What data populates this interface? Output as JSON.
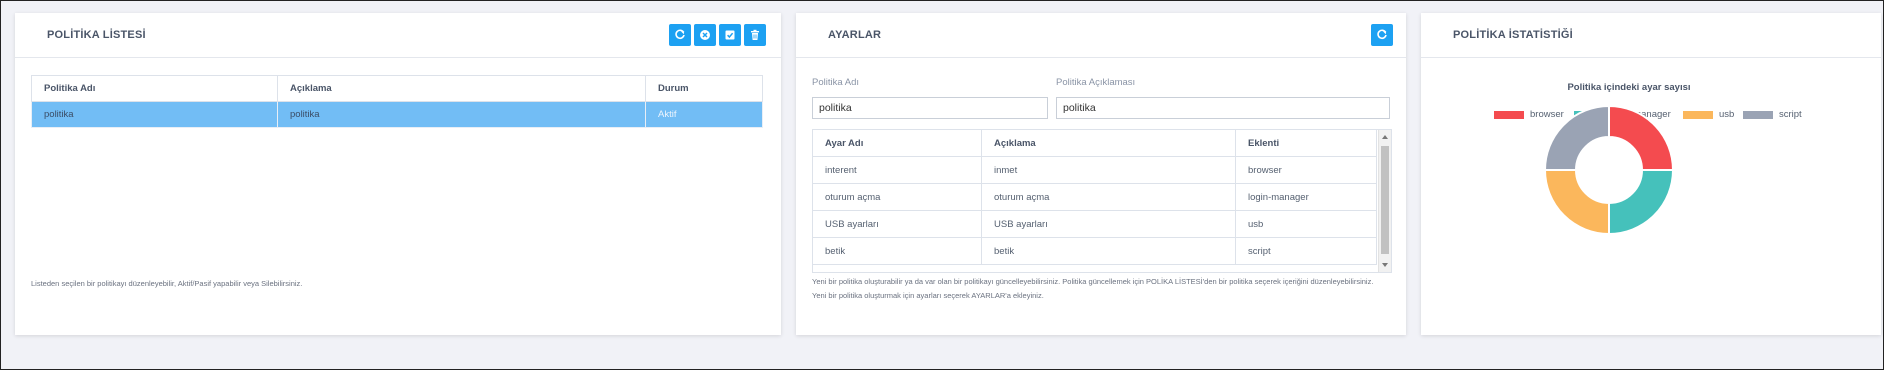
{
  "policy_list": {
    "title": "POLİTİKA LİSTESİ",
    "columns": [
      "Politika Adı",
      "Açıklama",
      "Durum"
    ],
    "rows": [
      {
        "name": "politika",
        "description": "politika",
        "status": "Aktif"
      }
    ],
    "note": "Listeden seçilen bir politikayı düzenleyebilir, Aktif/Pasif yapabilir veya Silebilirsiniz.",
    "buttons": [
      "refresh-icon",
      "close-icon",
      "check-icon",
      "trash-icon"
    ]
  },
  "settings": {
    "title": "AYARLAR",
    "name_label": "Politika Adı",
    "name_value": "politika",
    "desc_label": "Politika Açıklaması",
    "desc_value": "politika",
    "columns": [
      "Ayar Adı",
      "Açıklama",
      "Eklenti"
    ],
    "rows": [
      {
        "name": "interent",
        "description": "inmet",
        "plugin": "browser"
      },
      {
        "name": "oturum açma",
        "description": "oturum açma",
        "plugin": "login-manager"
      },
      {
        "name": "USB ayarları",
        "description": "USB ayarları",
        "plugin": "usb"
      },
      {
        "name": "betik",
        "description": "betik",
        "plugin": "script"
      }
    ],
    "note_line1": "Yeni bir politika oluşturabilir ya da var olan bir politikayı güncelleyebilirsiniz. Politika güncellemek için POLİKA LİSTESİ'den bir politika seçerek içeriğini düzenleyebilirsiniz.",
    "note_line2": "Yeni bir politika oluşturmak için ayarları seçerek AYARLAR'a ekleyiniz."
  },
  "statistics": {
    "title": "POLİTİKA İSTATİSTİĞİ"
  },
  "chart_data": {
    "type": "pie",
    "donut": true,
    "title": "Politika içindeki ayar sayısı",
    "legend_position": "top",
    "categories": [
      "browser",
      "login-manager",
      "usb",
      "script"
    ],
    "values": [
      1,
      1,
      1,
      1
    ],
    "colors": [
      "#f44b4f",
      "#45c1bb",
      "#fbb75c",
      "#9aa3b4"
    ]
  },
  "colors": {
    "accent": "#1da1f2",
    "selected_row": "#72bdf5"
  }
}
